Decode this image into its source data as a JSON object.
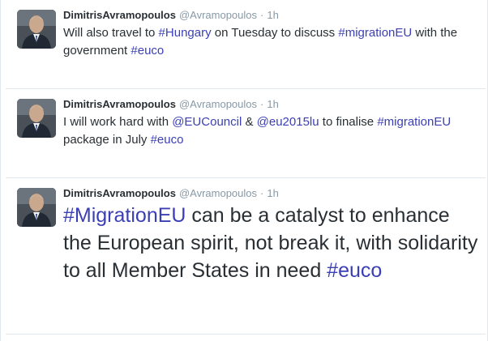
{
  "tweets": [
    {
      "name": "DimitrisAvramopoulos",
      "handle": "@Avramopoulos",
      "dot": "·",
      "time": "1h",
      "segments": [
        {
          "t": "Will also travel to ",
          "link": false
        },
        {
          "t": "#Hungary",
          "link": true
        },
        {
          "t": " on Tuesday to discuss ",
          "link": false
        },
        {
          "t": "#migrationEU",
          "link": true
        },
        {
          "t": " with the government ",
          "link": false
        },
        {
          "t": "#euco",
          "link": true
        }
      ]
    },
    {
      "name": "DimitrisAvramopoulos",
      "handle": "@Avramopoulos",
      "dot": "·",
      "time": "1h",
      "segments": [
        {
          "t": "I will work hard with ",
          "link": false
        },
        {
          "t": "@EUCouncil",
          "link": true
        },
        {
          "t": " & ",
          "link": false
        },
        {
          "t": "@eu2015lu",
          "link": true
        },
        {
          "t": " to finalise ",
          "link": false
        },
        {
          "t": "#migrationEU",
          "link": true
        },
        {
          "t": " package in July ",
          "link": false
        },
        {
          "t": "#euco",
          "link": true
        }
      ]
    },
    {
      "name": "DimitrisAvramopoulos",
      "handle": "@Avramopoulos",
      "dot": "·",
      "time": "1h",
      "segments": [
        {
          "t": "#MigrationEU",
          "link": true
        },
        {
          "t": " can be a catalyst to enhance the European spirit, not break it, with solidarity to all Member States in need ",
          "link": false
        },
        {
          "t": "#euco",
          "link": true
        }
      ]
    }
  ],
  "colors": {
    "link": "#3b3fb5",
    "text": "#292f33",
    "meta": "#8899a6",
    "divider": "#e1e8ed"
  }
}
